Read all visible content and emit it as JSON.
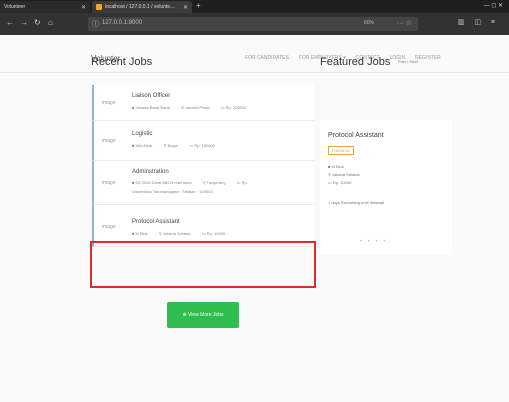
{
  "browser": {
    "tab1_title": "Volunteer",
    "tab2_title": "localhost / 127.0.0.1 / volunte...",
    "new_tab": "+",
    "url": "127.0.0.1:8000",
    "zoom": "80%",
    "window_controls": "— ◻ ✕"
  },
  "site": {
    "brand": "Volunter",
    "nav": [
      "FOR CANDIDATES",
      "FOR EMPLOYERS ▾",
      "CONTACT",
      "LOGIN",
      "REGISTER"
    ]
  },
  "recent": {
    "title": "Recent Jobs",
    "jobs": [
      {
        "image": "image",
        "title": "Liaison Officer",
        "company": "Jakarta Barat Barat",
        "location": "Jakarta Pusat",
        "salary": "Rp. 200000",
        "extra": ""
      },
      {
        "image": "image",
        "title": "Logistic",
        "company": "Wid Ahok",
        "location": "Bogor",
        "salary": "Rp. 150000",
        "extra": ""
      },
      {
        "image": "image",
        "title": "Adminstration",
        "company": "CE BSD Darat ABCN mall sena",
        "location": "Tangerang",
        "salary": "Rp.",
        "extra": "Universitas Tarumanagara · Selatan · 100000"
      },
      {
        "image": "image",
        "title": "Protocol Assistant",
        "company": "M Blok",
        "location": "Jakarta Selatan",
        "salary": "Rp. 10000",
        "extra": ""
      }
    ],
    "more_button": "View More Jobs"
  },
  "featured": {
    "title": "Featured Jobs",
    "links": "Prev | Next",
    "card": {
      "title": "Protocol Assistant",
      "badge": "Freelance",
      "company": "M Blok",
      "location": "Jakarta Selatan",
      "salary": "Rp. 10000",
      "deadline": "1 days Remaining until Ilmawati"
    },
    "dots": "• • • •"
  }
}
